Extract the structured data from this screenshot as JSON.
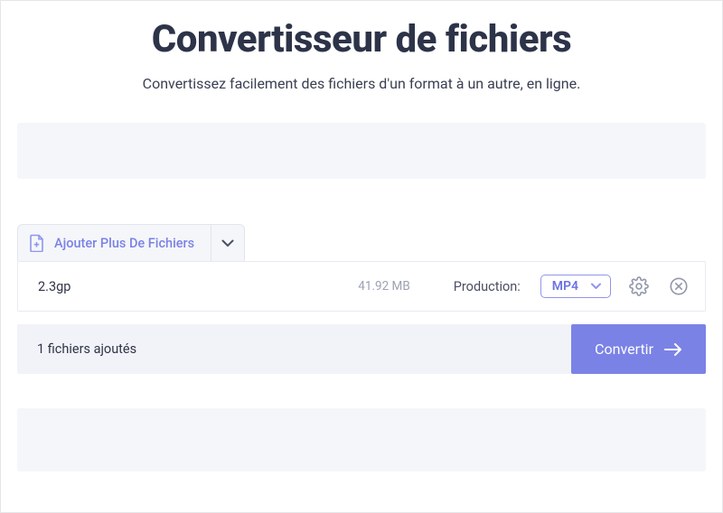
{
  "header": {
    "title": "Convertisseur de fichiers",
    "subtitle": "Convertissez facilement des fichiers d'un format à un autre, en ligne."
  },
  "toolbar": {
    "add_files_label": "Ajouter Plus De Fichiers"
  },
  "file": {
    "name": "2.3gp",
    "size": "41.92 MB",
    "output_label": "Production:",
    "format": "MP4"
  },
  "footer": {
    "status": "1 fichiers ajoutés",
    "convert_label": "Convertir"
  }
}
